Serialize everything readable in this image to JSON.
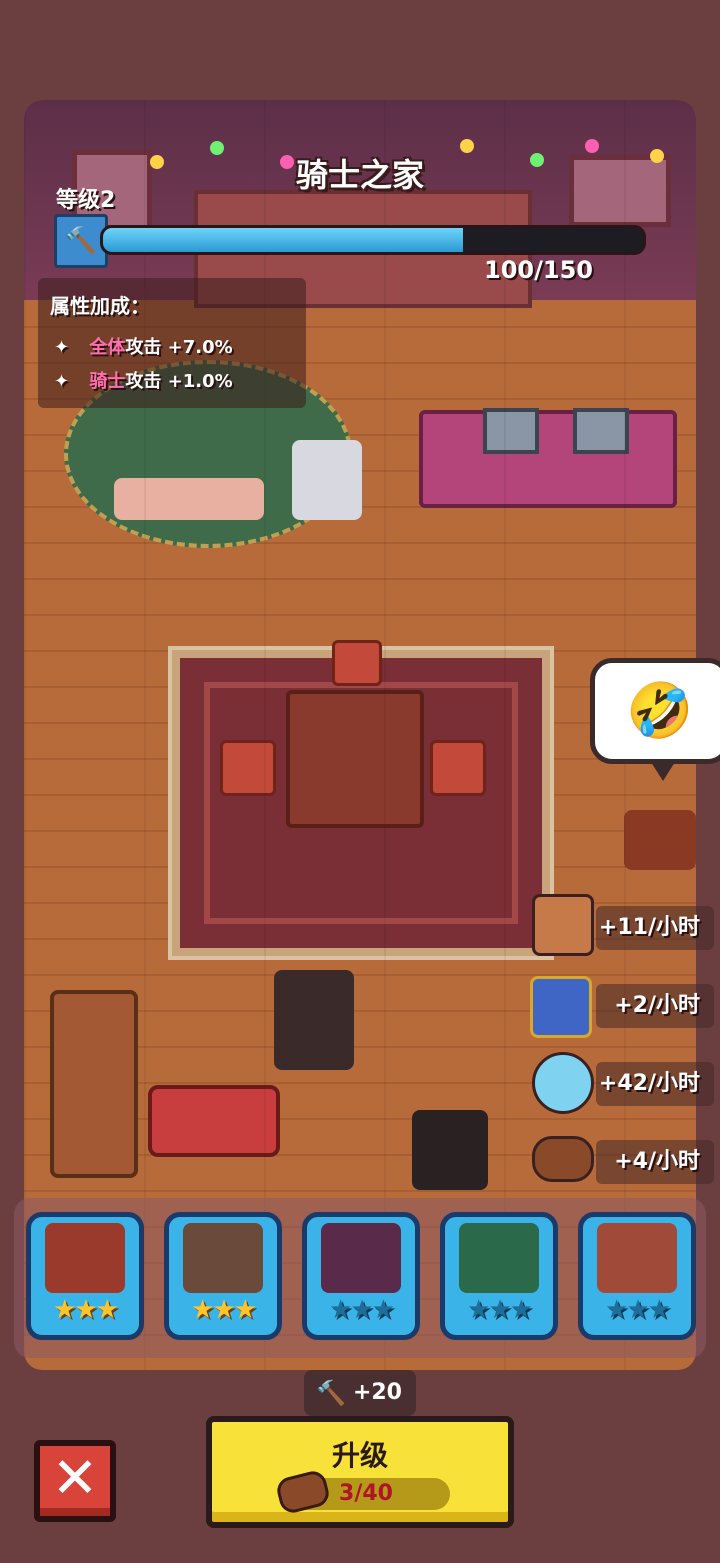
{
  "header": {
    "title": "骑士之家",
    "level_label": "等级2",
    "xp_text": "100/150",
    "xp_progress": 0.667
  },
  "bonus": {
    "title": "属性加成：",
    "rows": [
      {
        "bullet": "✦",
        "highlight": "全体",
        "text": "攻击 +7.0%"
      },
      {
        "bullet": "✦",
        "highlight": "骑士",
        "text": "攻击 +1.0%"
      }
    ]
  },
  "speech_bubble": {
    "emoji": "🤣"
  },
  "income_rates": [
    {
      "text": "+11/小时",
      "icon": "crown-book-icon"
    },
    {
      "text": "+2/小时",
      "icon": "mystery-chest-icon"
    },
    {
      "text": "+42/小时",
      "icon": "crystal-orb-icon"
    },
    {
      "text": "+4/小时",
      "icon": "wood-log-icon"
    }
  ],
  "furniture_cards": [
    {
      "name": "dining-table",
      "stars": "★★★",
      "filled": 3
    },
    {
      "name": "computer-desk",
      "stars": "★★★",
      "filled": 3
    },
    {
      "name": "arcade-corner",
      "stars": "★★★",
      "filled": 0
    },
    {
      "name": "billiard-table",
      "stars": "★★★",
      "filled": 0
    },
    {
      "name": "plant-table",
      "stars": "★★★",
      "filled": 0
    }
  ],
  "upgrade": {
    "cost_label": "+20",
    "button_label": "升级",
    "material_progress": "3/40"
  },
  "close_button": {
    "label": "✕"
  },
  "colors": {
    "accent_blue": "#3ab4e8",
    "button_yellow": "#f8e23a",
    "close_red": "#d9443a",
    "highlight_pink": "#ff6fb0"
  }
}
